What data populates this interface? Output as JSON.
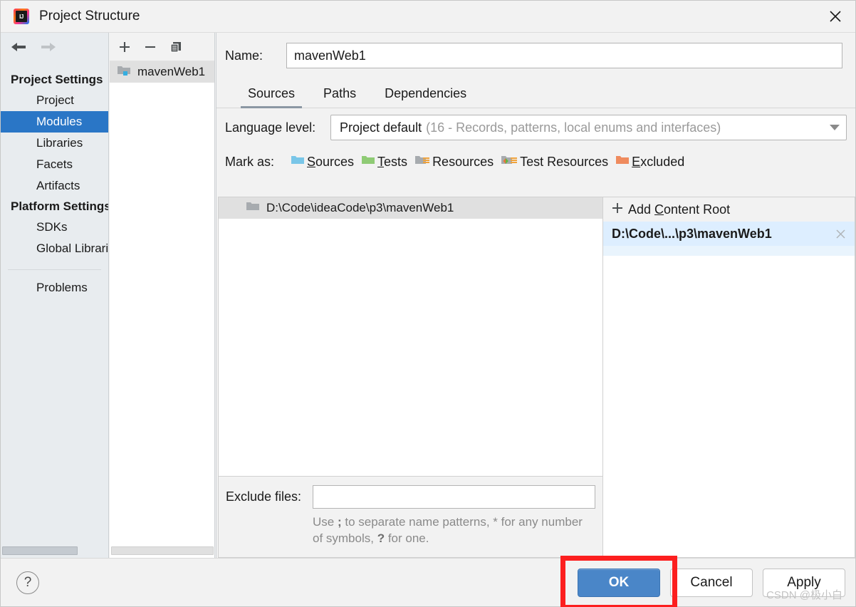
{
  "window": {
    "title": "Project Structure",
    "logo_text": "IJ",
    "close_icon": "close-icon"
  },
  "sidebar": {
    "back_icon": "arrow-left-icon",
    "forward_icon": "arrow-right-icon",
    "groups": [
      {
        "label": "Project Settings",
        "items": [
          {
            "label": "Project",
            "selected": false
          },
          {
            "label": "Modules",
            "selected": true
          },
          {
            "label": "Libraries",
            "selected": false
          },
          {
            "label": "Facets",
            "selected": false
          },
          {
            "label": "Artifacts",
            "selected": false
          }
        ]
      },
      {
        "label": "Platform Settings",
        "items": [
          {
            "label": "SDKs",
            "selected": false
          },
          {
            "label": "Global Libraries",
            "selected": false
          }
        ]
      }
    ],
    "problems_label": "Problems"
  },
  "modules_panel": {
    "toolbar": {
      "add_icon": "plus-icon",
      "remove_icon": "minus-icon",
      "copy_icon": "copy-icon"
    },
    "items": [
      {
        "label": "mavenWeb1",
        "icon": "module-folder-icon",
        "selected": true
      }
    ]
  },
  "main": {
    "name_label": "Name:",
    "name_value": "mavenWeb1",
    "tabs": [
      {
        "label": "Sources",
        "active": true
      },
      {
        "label": "Paths",
        "active": false
      },
      {
        "label": "Dependencies",
        "active": false
      }
    ],
    "language_level": {
      "label": "Language level:",
      "value": "Project default",
      "hint": "(16 - Records, patterns, local enums and interfaces)",
      "arrow_icon": "chevron-down-icon"
    },
    "mark_as": {
      "label": "Mark as:",
      "options": [
        {
          "mnemonic": "S",
          "rest": "ources",
          "icon": "sources-folder-icon",
          "color": "#79c6e8"
        },
        {
          "mnemonic": "T",
          "rest": "ests",
          "icon": "tests-folder-icon",
          "color": "#8fcb75"
        },
        {
          "mnemonic": "",
          "rest": "Resources",
          "icon": "resources-folder-icon",
          "color": "#a7abaf"
        },
        {
          "mnemonic": "",
          "rest": "Test Resources",
          "icon": "test-resources-folder-icon",
          "color": "#a7abaf"
        },
        {
          "mnemonic": "E",
          "rest": "xcluded",
          "icon": "excluded-folder-icon",
          "color": "#ef8b5e"
        }
      ]
    },
    "tree": {
      "root_label": "D:\\Code\\ideaCode\\p3\\mavenWeb1",
      "root_icon": "folder-icon"
    },
    "exclude": {
      "label": "Exclude files:",
      "value": "",
      "hint_prefix": "Use ",
      "hint_semicolon": ";",
      "hint_mid": " to separate name patterns, * for any number of symbols, ",
      "hint_question": "?",
      "hint_suffix": " for one."
    },
    "content_roots": {
      "add_label_prefix": "Add ",
      "add_label_mnemonic": "C",
      "add_label_rest": "ontent Root",
      "add_icon": "plus-icon",
      "items": [
        {
          "label": "D:\\Code\\...\\p3\\mavenWeb1",
          "remove_icon": "close-icon",
          "selected": true
        }
      ]
    }
  },
  "footer": {
    "help_label": "?",
    "help_icon": "help-icon",
    "ok_label": "OK",
    "cancel_label": "Cancel",
    "apply_label": "Apply",
    "annotation_color": "#fc1f1f",
    "accent_color": "#4a86c8"
  },
  "watermark": "CSDN @极小白"
}
